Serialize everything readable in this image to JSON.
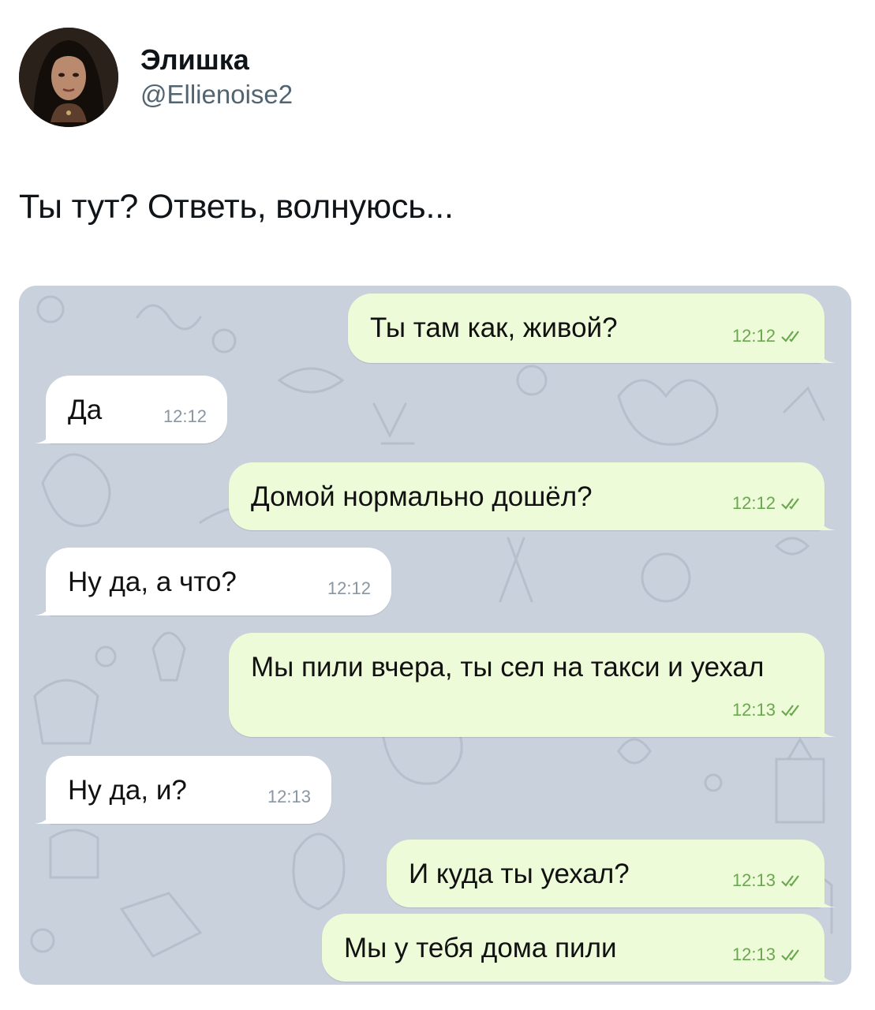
{
  "tweet": {
    "display_name": "Элишка",
    "handle": "@Ellienoise2",
    "text": "Ты тут? Ответь, волнуюсь..."
  },
  "chat": {
    "messages": [
      {
        "side": "out",
        "text": "Ты там как, живой?",
        "time": "12:12",
        "status": "read"
      },
      {
        "side": "in",
        "text": "Да",
        "time": "12:12"
      },
      {
        "side": "out",
        "text": "Домой нормально дошёл?",
        "time": "12:12",
        "status": "read"
      },
      {
        "side": "in",
        "text": "Ну да, а что?",
        "time": "12:12"
      },
      {
        "side": "out",
        "text": "Мы пили вчера, ты сел на такси и уехал",
        "time": "12:13",
        "status": "read"
      },
      {
        "side": "in",
        "text": "Ну да, и?",
        "time": "12:13"
      },
      {
        "side": "out",
        "text": "И куда ты уехал?",
        "time": "12:13",
        "status": "read"
      },
      {
        "side": "out",
        "text": "Мы у тебя дома пили",
        "time": "12:13",
        "status": "read"
      }
    ]
  },
  "colors": {
    "outgoing_bubble": "#eefbd8",
    "incoming_bubble": "#ffffff",
    "chat_background": "#c9d1dc",
    "read_check": "#6aa84f"
  }
}
